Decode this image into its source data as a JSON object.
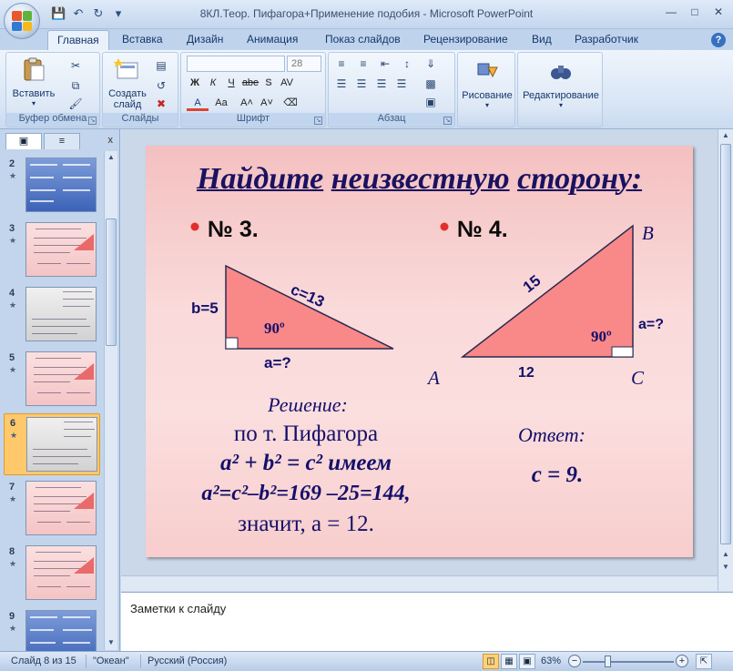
{
  "window": {
    "title": "8КЛ.Теор. Пифагора+Применение подобия - Microsoft PowerPoint"
  },
  "ribbon": {
    "tabs": [
      "Главная",
      "Вставка",
      "Дизайн",
      "Анимация",
      "Показ слайдов",
      "Рецензирование",
      "Вид",
      "Разработчик"
    ],
    "active_tab": "Главная",
    "clipboard": {
      "paste_label": "Вставить",
      "group_label": "Буфер обмена"
    },
    "slides": {
      "create_label": "Создать\nслайд",
      "group_label": "Слайды"
    },
    "font": {
      "font_name": "",
      "font_size": "28",
      "group_label": "Шрифт"
    },
    "paragraph": {
      "group_label": "Абзац"
    },
    "drawing": {
      "label": "Рисование"
    },
    "editing": {
      "label": "Редактирование"
    }
  },
  "slide_panel": {
    "close": "x",
    "slides": [
      {
        "num": "2",
        "style": "blue"
      },
      {
        "num": "3",
        "style": "pink"
      },
      {
        "num": "4",
        "style": "gray"
      },
      {
        "num": "5",
        "style": "pink"
      },
      {
        "num": "6",
        "style": "gray",
        "selected": true
      },
      {
        "num": "7",
        "style": "pink"
      },
      {
        "num": "8",
        "style": "pink"
      },
      {
        "num": "9",
        "style": "blue"
      }
    ]
  },
  "slide": {
    "title_words": [
      "Найдите",
      "неизвестную",
      "сторону:"
    ],
    "problem3": {
      "heading": "№ 3.",
      "side_b": "b=5",
      "side_c": "c=13",
      "side_a": "a=?",
      "angle": "90º"
    },
    "problem4": {
      "heading": "№ 4.",
      "vertex_a": "A",
      "vertex_b": "B",
      "vertex_c": "C",
      "hyp": "15",
      "base": "12",
      "side_a": "a=?",
      "angle": "90º"
    },
    "solution": {
      "heading": "Решение:",
      "line1": "по т. Пифагора",
      "line2": "a² + b² = c² имеем",
      "line3": "a²=c²–b²=169 –25=144,",
      "line4": "значит, a = 12."
    },
    "answer": {
      "heading": "Ответ:",
      "value": "c = 9."
    },
    "colors": {
      "triangle_fill": "#f98888",
      "title": "#1a1260",
      "bullet": "#e0302a"
    }
  },
  "notes": {
    "placeholder": "Заметки к слайду"
  },
  "status_bar": {
    "slide_info": "Слайд 8 из 15",
    "theme": "\"Океан\"",
    "language": "Русский (Россия)",
    "zoom": "63%",
    "zoom_level": 0.63
  }
}
